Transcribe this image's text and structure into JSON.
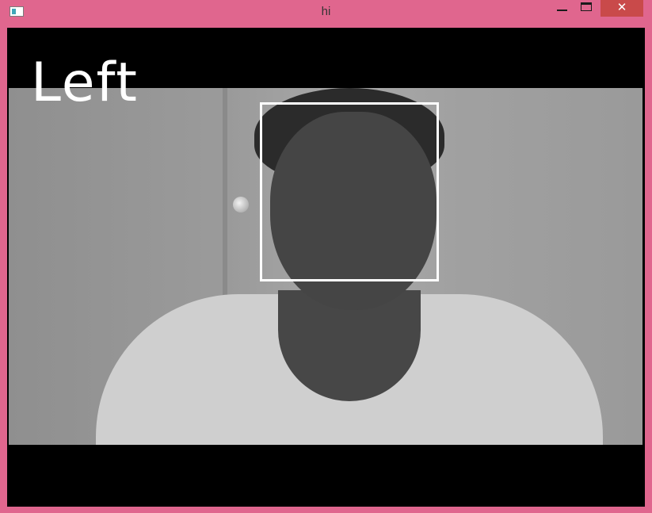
{
  "window": {
    "title": "hi",
    "close_glyph": "✕",
    "icons": {
      "app": "app-window-icon",
      "minimize": "minimize-icon",
      "maximize": "maximize-icon",
      "close": "close-icon"
    }
  },
  "frame": {
    "direction_label": "Left"
  },
  "colors": {
    "titlebar": "#e0668e",
    "close_button": "#c94a4a",
    "letterbox": "#000000",
    "overlay": "#ffffff"
  }
}
